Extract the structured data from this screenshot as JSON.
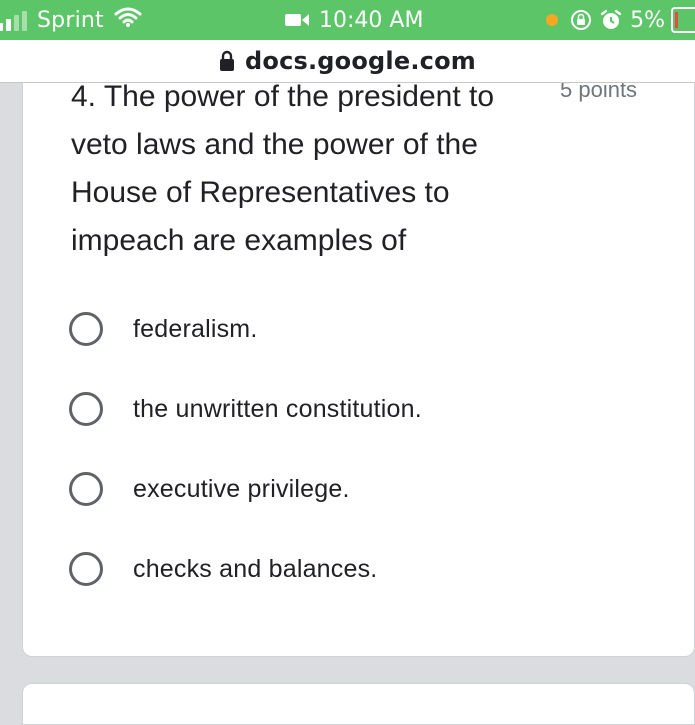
{
  "status_bar": {
    "carrier": "Sprint",
    "time": "10:40 AM",
    "battery": "5%",
    "icons": [
      "signal-icon",
      "wifi-icon",
      "video-icon",
      "orientation-lock-icon",
      "alarm-icon",
      "battery-icon"
    ],
    "recording_dot_color": "#f5a623",
    "background_color": "#5bc568"
  },
  "browser": {
    "url": "docs.google.com"
  },
  "question": {
    "text": "4. The power of the president to veto laws and the power of the House of Representatives to impeach are examples of",
    "points": "5 points",
    "options": [
      {
        "label": "federalism.",
        "selected": false
      },
      {
        "label": "the unwritten constitution.",
        "selected": false
      },
      {
        "label": "executive privilege.",
        "selected": false
      },
      {
        "label": "checks and balances.",
        "selected": false
      }
    ]
  }
}
